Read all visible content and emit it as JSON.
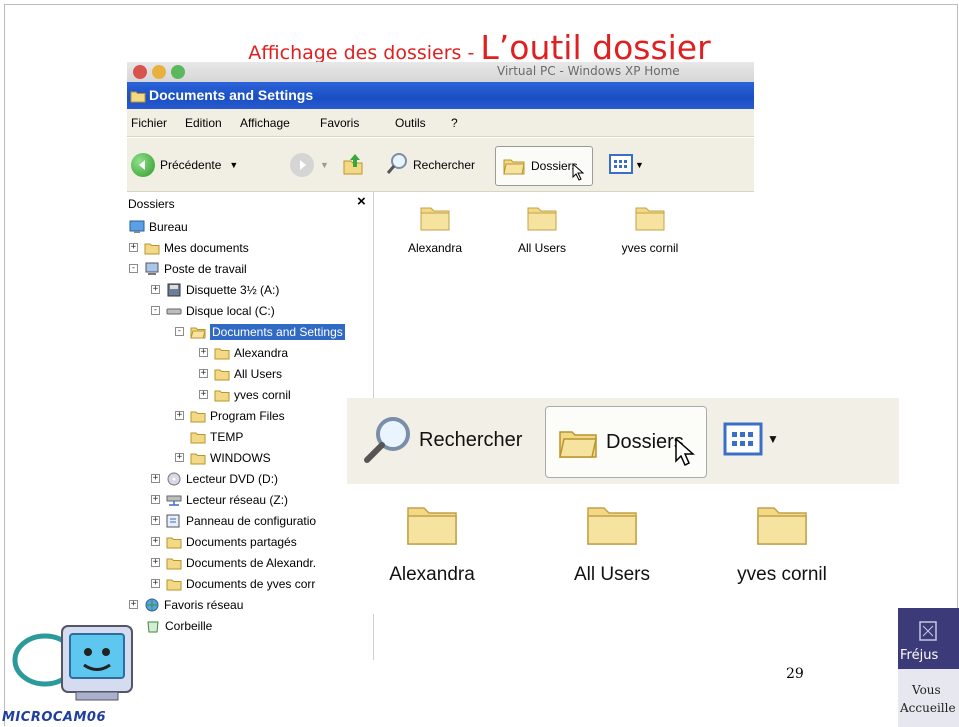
{
  "slide": {
    "title_prefix": "Affichage des dossiers - ",
    "title_main": "L’outil dossier",
    "page_number": "29",
    "left_logo": "MICROCAM06",
    "right_logo_city": "Fréjus",
    "right_logo_line1": "Vous",
    "right_logo_line2": "Accueille"
  },
  "window": {
    "faded_title": "Virtual PC - Windows XP Home",
    "title": "Documents and Settings",
    "menu": [
      "Fichier",
      "Edition",
      "Affichage",
      "Favoris",
      "Outils",
      "?"
    ],
    "toolbar": {
      "back": "Précédente",
      "search": "Rechercher",
      "folders": "Dossiers"
    }
  },
  "left_pane": {
    "header": "Dossiers",
    "close": "×",
    "tree": [
      {
        "label": "Bureau"
      },
      {
        "label": "Mes documents"
      },
      {
        "label": "Poste de travail"
      },
      {
        "label": "Disquette 3½ (A:)"
      },
      {
        "label": "Disque local (C:)"
      },
      {
        "label": "Documents and Settings"
      },
      {
        "label": "Alexandra"
      },
      {
        "label": "All Users"
      },
      {
        "label": "yves cornil"
      },
      {
        "label": "Program Files"
      },
      {
        "label": "TEMP"
      },
      {
        "label": "WINDOWS"
      },
      {
        "label": "Lecteur DVD (D:)"
      },
      {
        "label": "Lecteur réseau (Z:)"
      },
      {
        "label": "Panneau de configuratio"
      },
      {
        "label": "Documents partagés"
      },
      {
        "label": "Documents de Alexandr."
      },
      {
        "label": "Documents de yves corr"
      },
      {
        "label": "Favoris réseau"
      },
      {
        "label": "Corbeille"
      }
    ]
  },
  "right_pane": {
    "folders": [
      "Alexandra",
      "All Users",
      "yves cornil"
    ]
  },
  "zoom": {
    "search": "Rechercher",
    "folders": "Dossiers",
    "items": [
      "Alexandra",
      "All Users",
      "yves cornil"
    ]
  },
  "colors": {
    "title_red": "#e02020",
    "xp_blue": "#1a4fc4",
    "selection_blue": "#316ac5",
    "folder_yellow": "#f3d985"
  },
  "icons": [
    "folder-icon",
    "desktop-icon",
    "my-computer-icon",
    "floppy-icon",
    "hard-disk-icon",
    "dvd-icon",
    "network-drive-icon",
    "control-panel-icon",
    "network-places-icon",
    "recycle-bin-icon",
    "search-icon",
    "views-icon",
    "cursor-icon"
  ]
}
